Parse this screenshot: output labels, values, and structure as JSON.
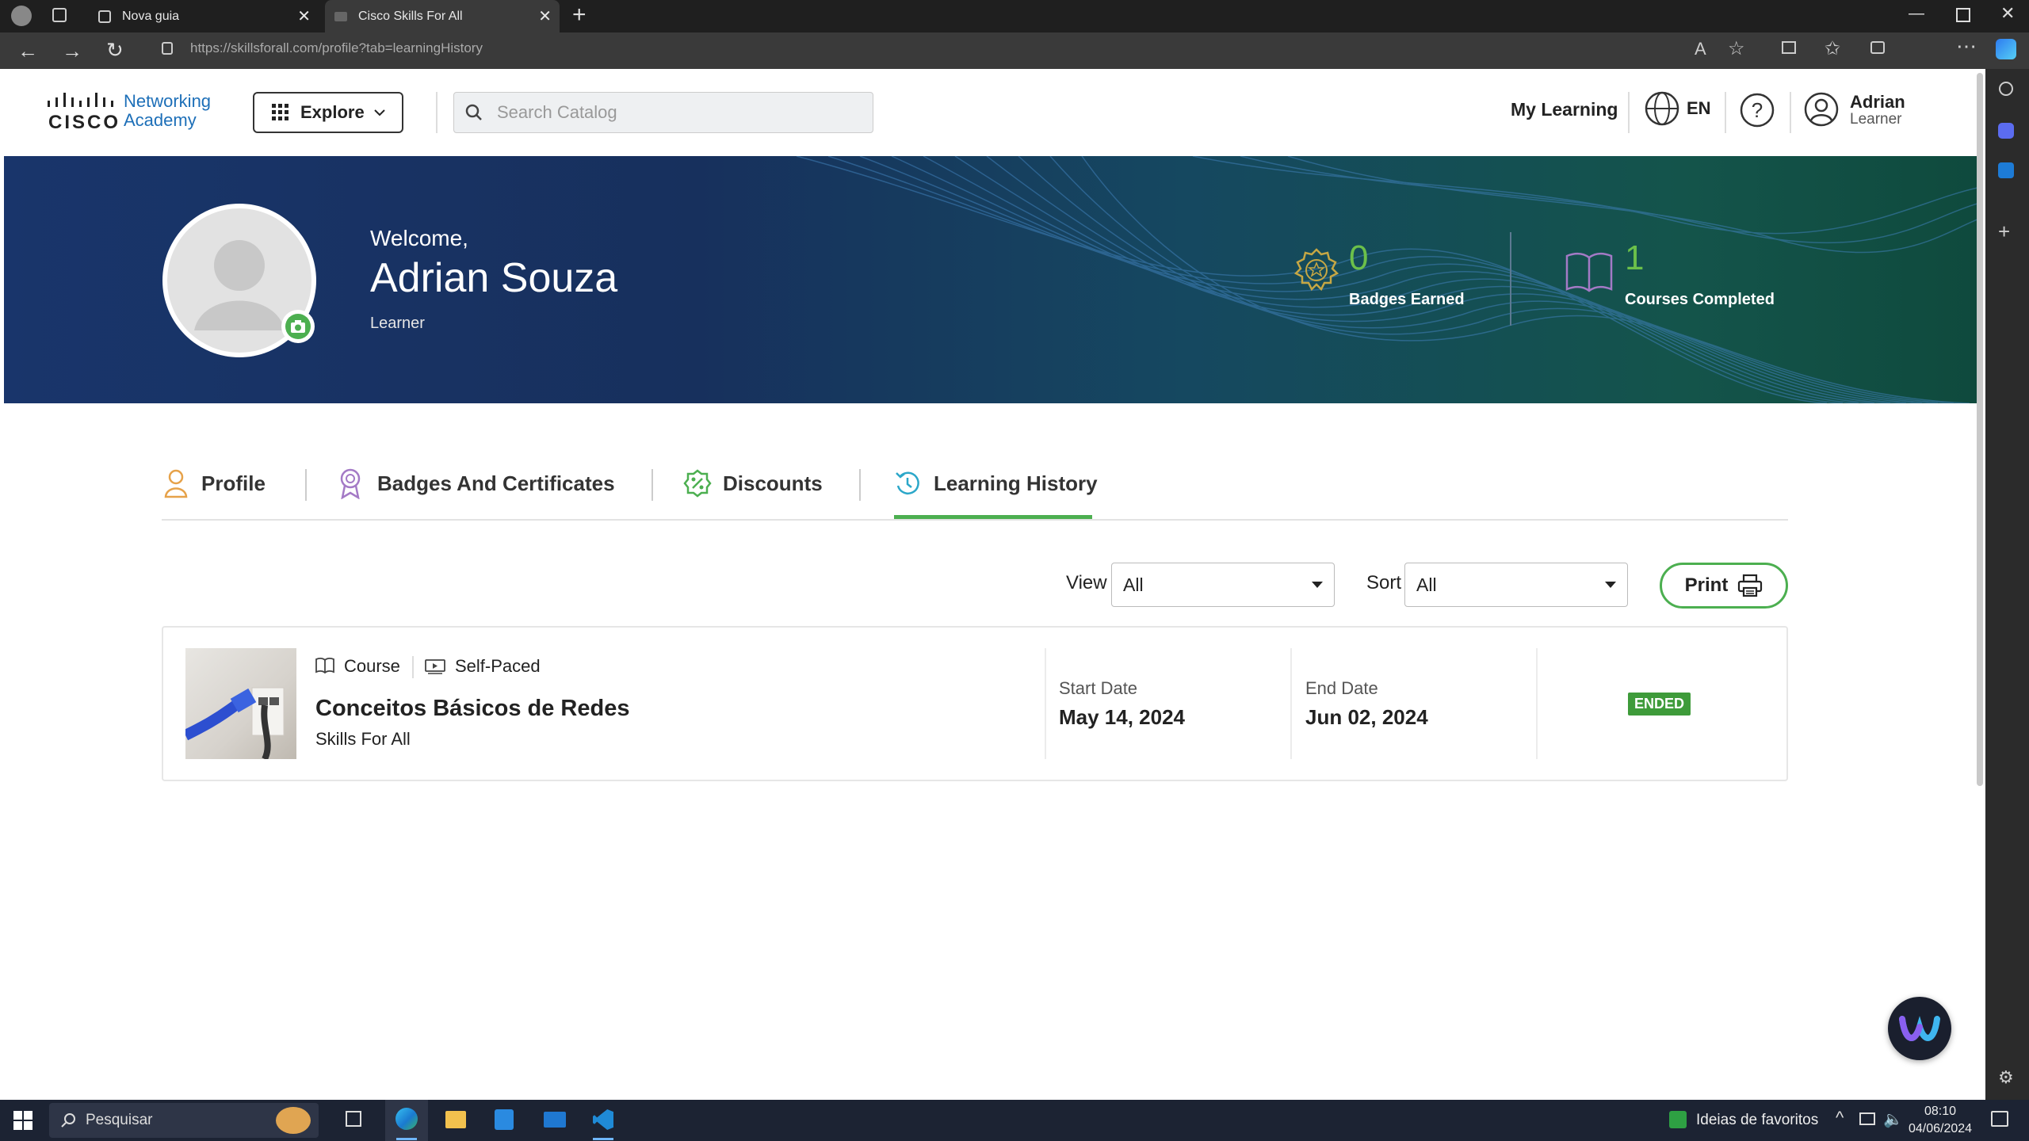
{
  "browser": {
    "tabs": [
      {
        "title": "Nova guia"
      },
      {
        "title": "Cisco Skills For All"
      }
    ],
    "url": "https://skillsforall.com/profile?tab=learningHistory"
  },
  "header": {
    "logo_line1": "Networking",
    "logo_line2": "Academy",
    "logo_brand": "CISCO",
    "explore_label": "Explore",
    "search_placeholder": "Search Catalog",
    "my_learning": "My Learning",
    "language": "EN",
    "user_name": "Adrian",
    "user_role": "Learner"
  },
  "banner": {
    "welcome": "Welcome,",
    "name": "Adrian Souza",
    "role": "Learner",
    "badges_count": "0",
    "badges_label": "Badges Earned",
    "courses_count": "1",
    "courses_label": "Courses Completed"
  },
  "tabs": [
    {
      "label": "Profile"
    },
    {
      "label": "Badges And Certificates"
    },
    {
      "label": "Discounts"
    },
    {
      "label": "Learning History",
      "active": true
    }
  ],
  "filters": {
    "view_label": "View",
    "view_value": "All",
    "sort_label": "Sort",
    "sort_value": "All",
    "print_label": "Print"
  },
  "courses": [
    {
      "type": "Course",
      "pace": "Self-Paced",
      "title": "Conceitos Básicos de Redes",
      "provider": "Skills For All",
      "start_label": "Start Date",
      "start_date": "May 14, 2024",
      "end_label": "End Date",
      "end_date": "Jun 02, 2024",
      "status": "ENDED"
    }
  ],
  "taskbar": {
    "search_placeholder": "Pesquisar",
    "news": "Ideias de favoritos",
    "time": "08:10",
    "date": "04/06/2024"
  },
  "colors": {
    "accent_green": "#4caf50",
    "status_green": "#3e9b3a",
    "banner_blue": "#19356b",
    "badge_gold": "#c6a744",
    "course_purple": "#a47ac6"
  }
}
